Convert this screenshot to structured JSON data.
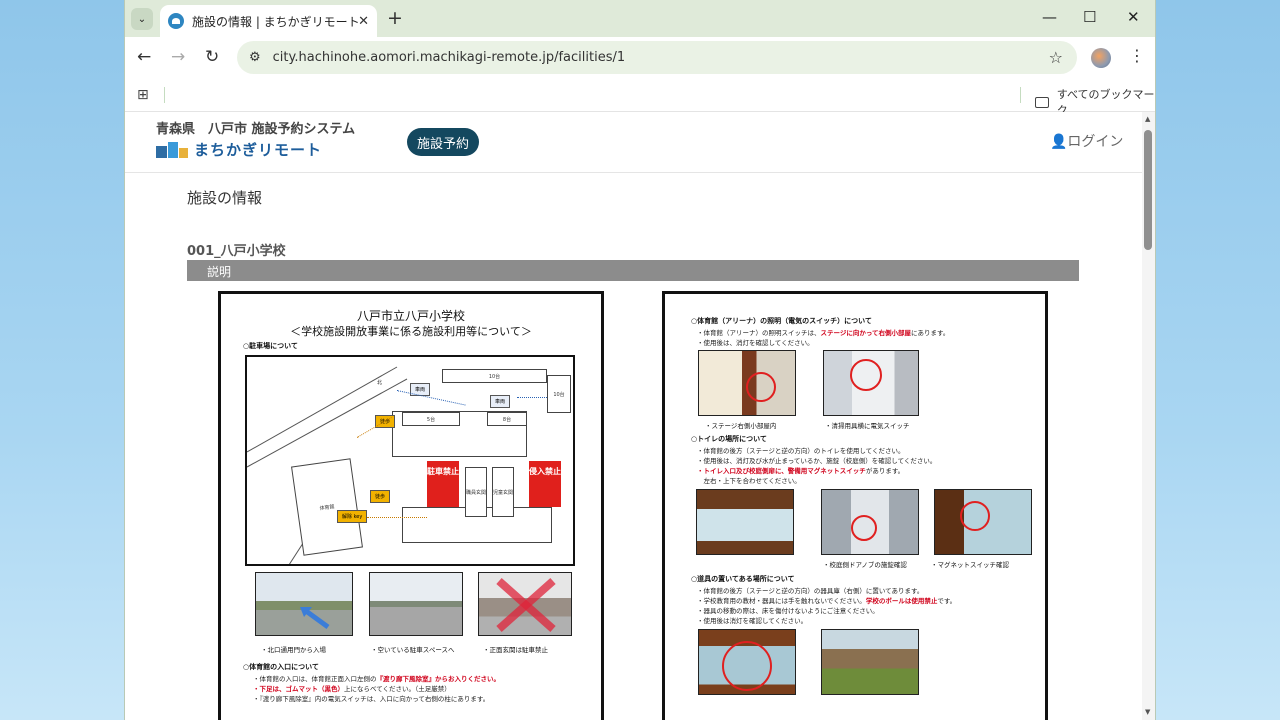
{
  "browser": {
    "tab_title": "施設の情報 | まちかぎリモート",
    "url": "city.hachinohe.aomori.machikagi-remote.jp/facilities/1",
    "bookmarks_label": "すべてのブックマーク",
    "new_tab": "+",
    "icons": {
      "back": "←",
      "forward": "→",
      "reload": "↻",
      "star": "☆",
      "minimize": "—",
      "maximize": "☐",
      "close": "✕",
      "menu": "⋮",
      "apps": "⊞",
      "tab_menu": "⌄",
      "tab_close": "✕",
      "tune": "⚙"
    }
  },
  "site": {
    "prefecture_line": "青森県　八戸市 施設予約システム",
    "logo_text": "まちかぎリモート",
    "reserve_button": "施設予約",
    "login": "👤ログイン"
  },
  "page": {
    "heading": "施設の情報",
    "facility_name": "001_八戸小学校",
    "section_label": "説明"
  },
  "doc_left": {
    "title1": "八戸市立八戸小学校",
    "title2": "＜学校施設開放事業に係る施設利用等について＞",
    "parking_heading": "○駐車場について",
    "map_labels": {
      "kita": "北",
      "car1": "車両",
      "car2": "車両",
      "sp10a": "10台",
      "sp10b": "10台",
      "sp5": "5台",
      "sp8": "8台",
      "walk1": "徒歩",
      "walk2": "徒歩",
      "key": "解除 key",
      "gym": "体育館",
      "no_parking": "駐車禁止",
      "no_entry": "侵入禁止",
      "staff_room": "職員玄関",
      "child_room": "児童玄関"
    },
    "captions": [
      "・北口通用門から入場",
      "・空いている駐車スペースへ",
      "・正面玄関は駐車禁止"
    ],
    "gym_entry_heading": "○体育館の入口について",
    "gym_lines": [
      {
        "pre": "・体育館の入口は、体育館正面入口左側の",
        "red": "『渡り廊下風除室』からお入りください。",
        "post": ""
      },
      {
        "pre": "",
        "red": "・下足は、ゴムマット（黒色）",
        "post": "上にならべてください。（土足厳禁）"
      },
      {
        "pre": "・『渡り廊下風除室』内の電気スイッチは、入口に向かって右側の柱にあります。",
        "red": "",
        "post": ""
      }
    ]
  },
  "doc_right": {
    "lighting_heading": "○体育館（アリーナ）の照明（電気のスイッチ）について",
    "lighting_lines": [
      {
        "pre": "・体育館（アリーナ）の照明スイッチは、",
        "red": "ステージに向かって右側小部屋",
        "post": "にあります。"
      },
      {
        "pre": "・使用後は、消灯を確認してください。",
        "red": "",
        "post": ""
      }
    ],
    "lighting_captions": [
      "・ステージ右側小部屋内",
      "・清掃用具横に電気スイッチ"
    ],
    "toilet_heading": "○トイレの場所について",
    "toilet_lines": [
      {
        "pre": "・体育館の後方（ステージと逆の方向）のトイレを使用してください。",
        "red": "",
        "post": ""
      },
      {
        "pre": "・使用後は、消灯及び水が止まっているか、施錠（校庭側）を確認してください。",
        "red": "",
        "post": ""
      },
      {
        "pre": "",
        "red": "・トイレ入口及び校庭側扉に、警備用マグネットスイッチ",
        "post": "があります。"
      },
      {
        "pre": "　左右・上下を合わせてください。",
        "red": "",
        "post": ""
      }
    ],
    "toilet_captions": [
      "・校庭側ドアノブの施錠確認",
      "・マグネットスイッチ確認"
    ],
    "equip_heading": "○道具の置いてある場所について",
    "equip_lines": [
      {
        "pre": "・体育館の後方（ステージと逆の方向）の器具庫（右側）に置いてあります。",
        "red": "",
        "post": ""
      },
      {
        "pre": "・学校教育用の教材・器具には手を触れないでください。",
        "red": "学校のボールは使用禁止",
        "post": "です。"
      },
      {
        "pre": "・器具の移動の際は、床を傷付けないようにご注意ください。",
        "red": "",
        "post": ""
      },
      {
        "pre": "・使用後は消灯を確認してください。",
        "red": "",
        "post": ""
      }
    ]
  }
}
